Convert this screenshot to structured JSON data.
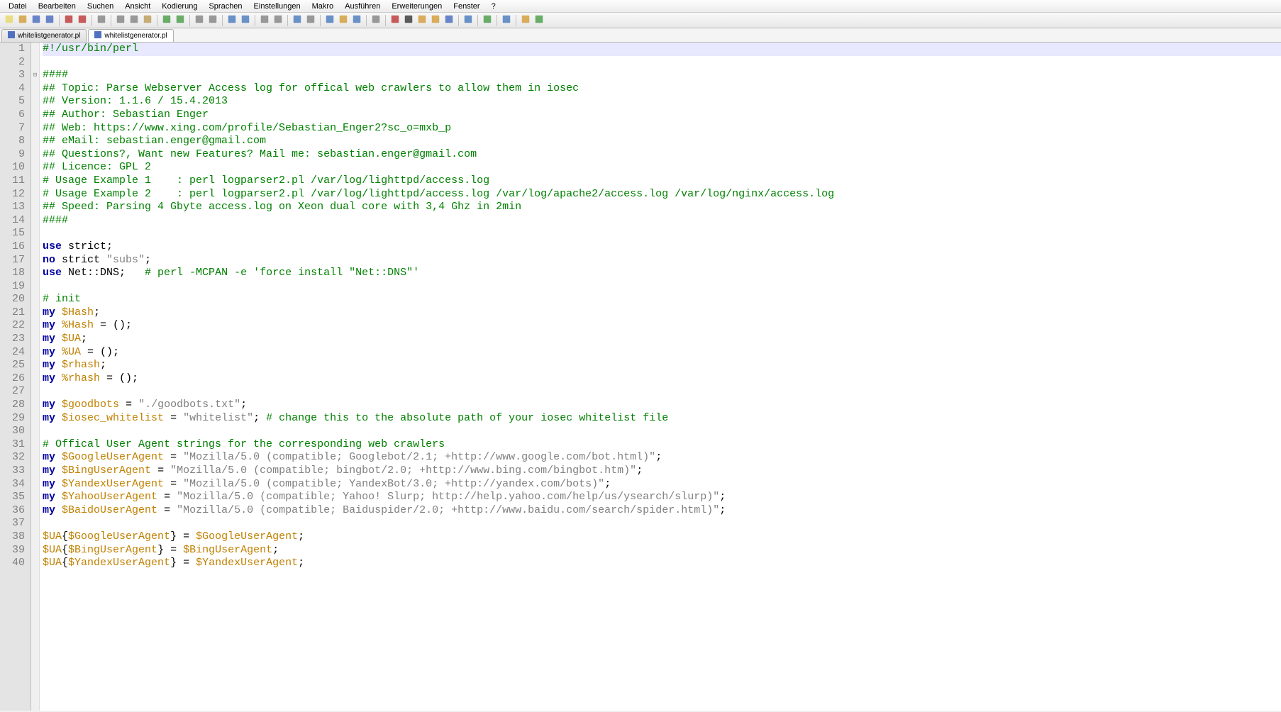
{
  "menu": [
    "Datei",
    "Bearbeiten",
    "Suchen",
    "Ansicht",
    "Kodierung",
    "Sprachen",
    "Einstellungen",
    "Makro",
    "Ausführen",
    "Erweiterungen",
    "Fenster",
    "?"
  ],
  "tabs": [
    {
      "label": "whitelistgenerator.pl",
      "active": false
    },
    {
      "label": "whitelistgenerator.pl",
      "active": true
    }
  ],
  "code": {
    "lines": [
      {
        "n": 1,
        "type": "comment",
        "text": "#!/usr/bin/perl",
        "current": true
      },
      {
        "n": 2,
        "type": "blank",
        "text": ""
      },
      {
        "n": 3,
        "type": "comment",
        "text": "####",
        "fold": "-"
      },
      {
        "n": 4,
        "type": "comment",
        "text": "## Topic: Parse Webserver Access log for offical web crawlers to allow them in iosec"
      },
      {
        "n": 5,
        "type": "comment",
        "text": "## Version: 1.1.6 / 15.4.2013"
      },
      {
        "n": 6,
        "type": "comment",
        "text": "## Author: Sebastian Enger"
      },
      {
        "n": 7,
        "type": "comment",
        "text": "## Web: https://www.xing.com/profile/Sebastian_Enger2?sc_o=mxb_p"
      },
      {
        "n": 8,
        "type": "comment",
        "text": "## eMail: sebastian.enger@gmail.com"
      },
      {
        "n": 9,
        "type": "comment",
        "text": "## Questions?, Want new Features? Mail me: sebastian.enger@gmail.com"
      },
      {
        "n": 10,
        "type": "comment",
        "text": "## Licence: GPL 2"
      },
      {
        "n": 11,
        "type": "comment",
        "text": "# Usage Example 1    : perl logparser2.pl /var/log/lighttpd/access.log"
      },
      {
        "n": 12,
        "type": "comment",
        "text": "# Usage Example 2    : perl logparser2.pl /var/log/lighttpd/access.log /var/log/apache2/access.log /var/log/nginx/access.log"
      },
      {
        "n": 13,
        "type": "comment",
        "text": "## Speed: Parsing 4 Gbyte access.log on Xeon dual core with 3,4 Ghz in 2min"
      },
      {
        "n": 14,
        "type": "comment",
        "text": "####"
      },
      {
        "n": 15,
        "type": "blank",
        "text": ""
      },
      {
        "n": 16,
        "type": "code",
        "tokens": [
          {
            "c": "keyword",
            "t": "use"
          },
          {
            "c": "punct",
            "t": " strict;"
          }
        ]
      },
      {
        "n": 17,
        "type": "code",
        "tokens": [
          {
            "c": "keyword",
            "t": "no"
          },
          {
            "c": "punct",
            "t": " strict "
          },
          {
            "c": "string",
            "t": "\"subs\""
          },
          {
            "c": "punct",
            "t": ";"
          }
        ]
      },
      {
        "n": 18,
        "type": "code",
        "tokens": [
          {
            "c": "keyword",
            "t": "use"
          },
          {
            "c": "punct",
            "t": " Net::DNS;   "
          },
          {
            "c": "comment",
            "t": "# perl -MCPAN -e 'force install \"Net::DNS\"'"
          }
        ]
      },
      {
        "n": 19,
        "type": "blank",
        "text": ""
      },
      {
        "n": 20,
        "type": "comment",
        "text": "# init"
      },
      {
        "n": 21,
        "type": "code",
        "tokens": [
          {
            "c": "keyword",
            "t": "my"
          },
          {
            "c": "punct",
            "t": " "
          },
          {
            "c": "var",
            "t": "$Hash"
          },
          {
            "c": "punct",
            "t": ";"
          }
        ]
      },
      {
        "n": 22,
        "type": "code",
        "tokens": [
          {
            "c": "keyword",
            "t": "my"
          },
          {
            "c": "punct",
            "t": " "
          },
          {
            "c": "var",
            "t": "%Hash"
          },
          {
            "c": "punct",
            "t": " = ();"
          }
        ]
      },
      {
        "n": 23,
        "type": "code",
        "tokens": [
          {
            "c": "keyword",
            "t": "my"
          },
          {
            "c": "punct",
            "t": " "
          },
          {
            "c": "var",
            "t": "$UA"
          },
          {
            "c": "punct",
            "t": ";"
          }
        ]
      },
      {
        "n": 24,
        "type": "code",
        "tokens": [
          {
            "c": "keyword",
            "t": "my"
          },
          {
            "c": "punct",
            "t": " "
          },
          {
            "c": "var",
            "t": "%UA"
          },
          {
            "c": "punct",
            "t": " = ();"
          }
        ]
      },
      {
        "n": 25,
        "type": "code",
        "tokens": [
          {
            "c": "keyword",
            "t": "my"
          },
          {
            "c": "punct",
            "t": " "
          },
          {
            "c": "var",
            "t": "$rhash"
          },
          {
            "c": "punct",
            "t": ";"
          }
        ]
      },
      {
        "n": 26,
        "type": "code",
        "tokens": [
          {
            "c": "keyword",
            "t": "my"
          },
          {
            "c": "punct",
            "t": " "
          },
          {
            "c": "var",
            "t": "%rhash"
          },
          {
            "c": "punct",
            "t": " = ();"
          }
        ]
      },
      {
        "n": 27,
        "type": "blank",
        "text": ""
      },
      {
        "n": 28,
        "type": "code",
        "tokens": [
          {
            "c": "keyword",
            "t": "my"
          },
          {
            "c": "punct",
            "t": " "
          },
          {
            "c": "var",
            "t": "$goodbots"
          },
          {
            "c": "punct",
            "t": " = "
          },
          {
            "c": "string",
            "t": "\"./goodbots.txt\""
          },
          {
            "c": "punct",
            "t": ";"
          }
        ]
      },
      {
        "n": 29,
        "type": "code",
        "tokens": [
          {
            "c": "keyword",
            "t": "my"
          },
          {
            "c": "punct",
            "t": " "
          },
          {
            "c": "var",
            "t": "$iosec_whitelist"
          },
          {
            "c": "punct",
            "t": " = "
          },
          {
            "c": "string",
            "t": "\"whitelist\""
          },
          {
            "c": "punct",
            "t": "; "
          },
          {
            "c": "comment",
            "t": "# change this to the absolute path of your iosec whitelist file"
          }
        ]
      },
      {
        "n": 30,
        "type": "blank",
        "text": ""
      },
      {
        "n": 31,
        "type": "comment",
        "text": "# Offical User Agent strings for the corresponding web crawlers"
      },
      {
        "n": 32,
        "type": "code",
        "tokens": [
          {
            "c": "keyword",
            "t": "my"
          },
          {
            "c": "punct",
            "t": " "
          },
          {
            "c": "var",
            "t": "$GoogleUserAgent"
          },
          {
            "c": "punct",
            "t": " = "
          },
          {
            "c": "string",
            "t": "\"Mozilla/5.0 (compatible; Googlebot/2.1; +http://www.google.com/bot.html)\""
          },
          {
            "c": "punct",
            "t": ";"
          }
        ]
      },
      {
        "n": 33,
        "type": "code",
        "tokens": [
          {
            "c": "keyword",
            "t": "my"
          },
          {
            "c": "punct",
            "t": " "
          },
          {
            "c": "var",
            "t": "$BingUserAgent"
          },
          {
            "c": "punct",
            "t": " = "
          },
          {
            "c": "string",
            "t": "\"Mozilla/5.0 (compatible; bingbot/2.0; +http://www.bing.com/bingbot.htm)\""
          },
          {
            "c": "punct",
            "t": ";"
          }
        ]
      },
      {
        "n": 34,
        "type": "code",
        "tokens": [
          {
            "c": "keyword",
            "t": "my"
          },
          {
            "c": "punct",
            "t": " "
          },
          {
            "c": "var",
            "t": "$YandexUserAgent"
          },
          {
            "c": "punct",
            "t": " = "
          },
          {
            "c": "string",
            "t": "\"Mozilla/5.0 (compatible; YandexBot/3.0; +http://yandex.com/bots)\""
          },
          {
            "c": "punct",
            "t": ";"
          }
        ]
      },
      {
        "n": 35,
        "type": "code",
        "tokens": [
          {
            "c": "keyword",
            "t": "my"
          },
          {
            "c": "punct",
            "t": " "
          },
          {
            "c": "var",
            "t": "$YahooUserAgent"
          },
          {
            "c": "punct",
            "t": " = "
          },
          {
            "c": "string",
            "t": "\"Mozilla/5.0 (compatible; Yahoo! Slurp; http://help.yahoo.com/help/us/ysearch/slurp)\""
          },
          {
            "c": "punct",
            "t": ";"
          }
        ]
      },
      {
        "n": 36,
        "type": "code",
        "tokens": [
          {
            "c": "keyword",
            "t": "my"
          },
          {
            "c": "punct",
            "t": " "
          },
          {
            "c": "var",
            "t": "$BaidoUserAgent"
          },
          {
            "c": "punct",
            "t": " = "
          },
          {
            "c": "string",
            "t": "\"Mozilla/5.0 (compatible; Baiduspider/2.0; +http://www.baidu.com/search/spider.html)\""
          },
          {
            "c": "punct",
            "t": ";"
          }
        ]
      },
      {
        "n": 37,
        "type": "blank",
        "text": ""
      },
      {
        "n": 38,
        "type": "code",
        "tokens": [
          {
            "c": "var",
            "t": "$UA"
          },
          {
            "c": "punct",
            "t": "{"
          },
          {
            "c": "var",
            "t": "$GoogleUserAgent"
          },
          {
            "c": "punct",
            "t": "} = "
          },
          {
            "c": "var",
            "t": "$GoogleUserAgent"
          },
          {
            "c": "punct",
            "t": ";"
          }
        ]
      },
      {
        "n": 39,
        "type": "code",
        "tokens": [
          {
            "c": "var",
            "t": "$UA"
          },
          {
            "c": "punct",
            "t": "{"
          },
          {
            "c": "var",
            "t": "$BingUserAgent"
          },
          {
            "c": "punct",
            "t": "} = "
          },
          {
            "c": "var",
            "t": "$BingUserAgent"
          },
          {
            "c": "punct",
            "t": ";"
          }
        ]
      },
      {
        "n": 40,
        "type": "code",
        "tokens": [
          {
            "c": "var",
            "t": "$UA"
          },
          {
            "c": "punct",
            "t": "{"
          },
          {
            "c": "var",
            "t": "$YandexUserAgent"
          },
          {
            "c": "punct",
            "t": "} = "
          },
          {
            "c": "var",
            "t": "$YandexUserAgent"
          },
          {
            "c": "punct",
            "t": ";"
          }
        ]
      }
    ]
  },
  "toolbar_icons": [
    "new-file",
    "open-file",
    "save-file",
    "save-all",
    "sep",
    "close-file",
    "close-all",
    "sep",
    "print",
    "sep",
    "cut",
    "copy",
    "paste",
    "sep",
    "undo",
    "redo",
    "sep",
    "find",
    "replace",
    "sep",
    "zoom-in",
    "zoom-out",
    "sep",
    "sync-v",
    "sync-h",
    "sep",
    "word-wrap",
    "show-all-chars",
    "sep",
    "indent-guide",
    "folder",
    "doc-map",
    "sep",
    "func-list",
    "sep",
    "record-macro",
    "stop-macro",
    "play-macro",
    "play-multi",
    "save-macro",
    "sep",
    "indent-left",
    "sep",
    "spell-check",
    "sep",
    "show-symbol",
    "sep",
    "doc-switcher",
    "monitoring"
  ]
}
